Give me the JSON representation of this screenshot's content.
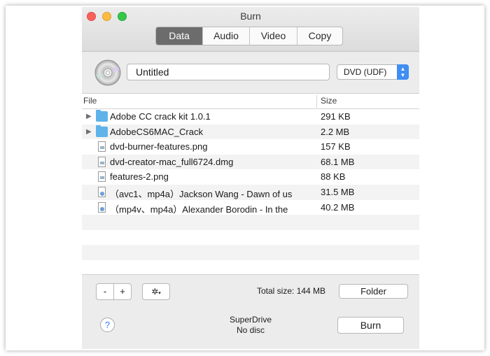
{
  "window": {
    "title": "Burn"
  },
  "tabs": [
    {
      "label": "Data",
      "active": true
    },
    {
      "label": "Audio",
      "active": false
    },
    {
      "label": "Video",
      "active": false
    },
    {
      "label": "Copy",
      "active": false
    }
  ],
  "disc": {
    "icon": "disc-icon",
    "name_value": "Untitled",
    "format_selected": "DVD (UDF)"
  },
  "table": {
    "columns": {
      "file": "File",
      "size": "Size"
    },
    "rows": [
      {
        "name": "Adobe CC crack kit 1.0.1",
        "size": "291 KB",
        "icon": "folder-icon",
        "expandable": true
      },
      {
        "name": "AdobeCS6MAC_Crack",
        "size": "2.2 MB",
        "icon": "folder-icon",
        "expandable": true
      },
      {
        "name": "dvd-burner-features.png",
        "size": "157 KB",
        "icon": "image-file-icon",
        "expandable": false
      },
      {
        "name": "dvd-creator-mac_full6724.dmg",
        "size": "68.1 MB",
        "icon": "disk-image-file-icon",
        "expandable": false
      },
      {
        "name": "features-2.png",
        "size": "88 KB",
        "icon": "image-file-icon",
        "expandable": false
      },
      {
        "name": "（avc1、mp4a）Jackson Wang - Dawn of us",
        "size": "31.5 MB",
        "icon": "video-file-icon",
        "expandable": false
      },
      {
        "name": "（mp4v、mp4a）Alexander Borodin - In the",
        "size": "40.2 MB",
        "icon": "video-file-icon",
        "expandable": false
      }
    ]
  },
  "bottom": {
    "minus_label": "-",
    "plus_label": "+",
    "gear_icon": "gear-icon",
    "total_size": "Total size: 144 MB",
    "folder_label": "Folder",
    "help_label": "?",
    "drive_name": "SuperDrive",
    "drive_status": "No disc",
    "burn_label": "Burn"
  },
  "colors": {
    "accent": "#3f8ef3",
    "active_tab": "#6c6c6c",
    "folder": "#5fb3ea",
    "close": "#fc605c",
    "minimize": "#fdbc40",
    "zoom": "#34c84a"
  }
}
